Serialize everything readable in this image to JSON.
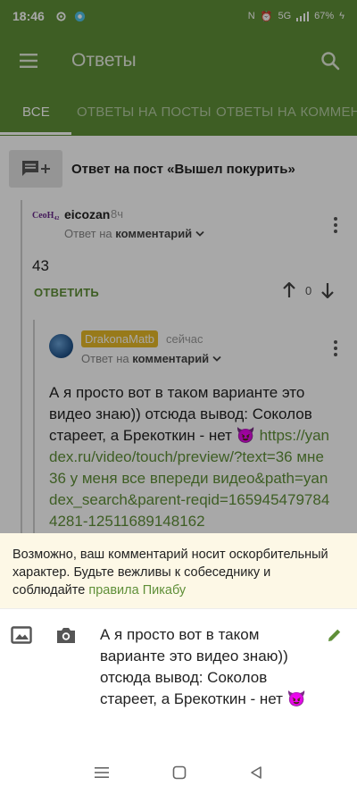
{
  "status_bar": {
    "time": "18:46",
    "network": "5G",
    "battery": "67%"
  },
  "app_bar": {
    "title": "Ответы"
  },
  "tabs": [
    {
      "label": "ВСЕ",
      "active": true
    },
    {
      "label": "ОТВЕТЫ НА ПОСТЫ",
      "active": false
    },
    {
      "label": "ОТВЕТЫ НА КОММЕНТ",
      "active": false
    }
  ],
  "post": {
    "title": "Ответ на пост «Вышел покурить»"
  },
  "comment1": {
    "avatar_text": "CeoH₄₂",
    "author": "eicozan",
    "time": "8ч",
    "reply_prefix": "Ответ на",
    "reply_target": "комментарий",
    "text": "43",
    "reply_button": "ОТВЕТИТЬ",
    "votes": "0"
  },
  "comment2": {
    "author": "DrakonaMatb",
    "time": "сейчас",
    "reply_prefix": "Ответ на",
    "reply_target": "комментарий",
    "text": "А я просто вот в таком варианте это видео знаю)) отсюда вывод: Соколов стареет, а Брекоткин - нет 😈",
    "link": "https://yandex.ru/video/touch/preview/?text=36 мне 36 у меня все впереди видео&path=yandex_search&parent-reqid=1659454797844281-12511689148162"
  },
  "warning": {
    "text": "Возможно, ваш комментарий носит оскорбительный характер. Будьте вежливы к собеседнику и соблюдайте",
    "rules_link": "правила Пикабу"
  },
  "composer": {
    "draft": "А я просто вот в таком варианте это видео знаю)) отсюда вывод: Соколов стареет, а Брекоткин - нет 😈"
  },
  "colors": {
    "brand": "#5f8f38",
    "warning_bg": "#fdf8e6"
  }
}
